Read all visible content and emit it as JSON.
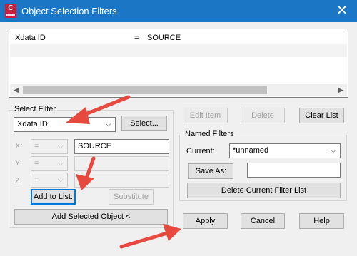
{
  "window": {
    "title": "Object Selection Filters",
    "app_icon_letter": "C"
  },
  "filter_list": {
    "rows": [
      {
        "attribute": "Xdata ID",
        "operator": "=",
        "value": "SOURCE"
      }
    ]
  },
  "select_filter": {
    "label": "Select Filter",
    "type_value": "Xdata ID",
    "select_button": "Select...",
    "x": {
      "label": "X:",
      "operator": "=",
      "value": "SOURCE"
    },
    "y": {
      "label": "Y:",
      "operator": "=",
      "value": ""
    },
    "z": {
      "label": "Z:",
      "operator": "=",
      "value": ""
    },
    "add_to_list": "Add to List:",
    "substitute": "Substitute",
    "add_selected_object": "Add Selected Object <"
  },
  "list_buttons": {
    "edit_item": "Edit Item",
    "delete": "Delete",
    "clear_list": "Clear List"
  },
  "named_filters": {
    "label": "Named Filters",
    "current_label": "Current:",
    "current_value": "*unnamed",
    "save_as": "Save As:",
    "save_as_value": "",
    "delete_current": "Delete Current Filter List"
  },
  "dialog_buttons": {
    "apply": "Apply",
    "cancel": "Cancel",
    "help": "Help"
  },
  "colors": {
    "title_bar": "#1c76c6",
    "annotation_arrow": "#e8493e",
    "focus": "#0078d7"
  }
}
